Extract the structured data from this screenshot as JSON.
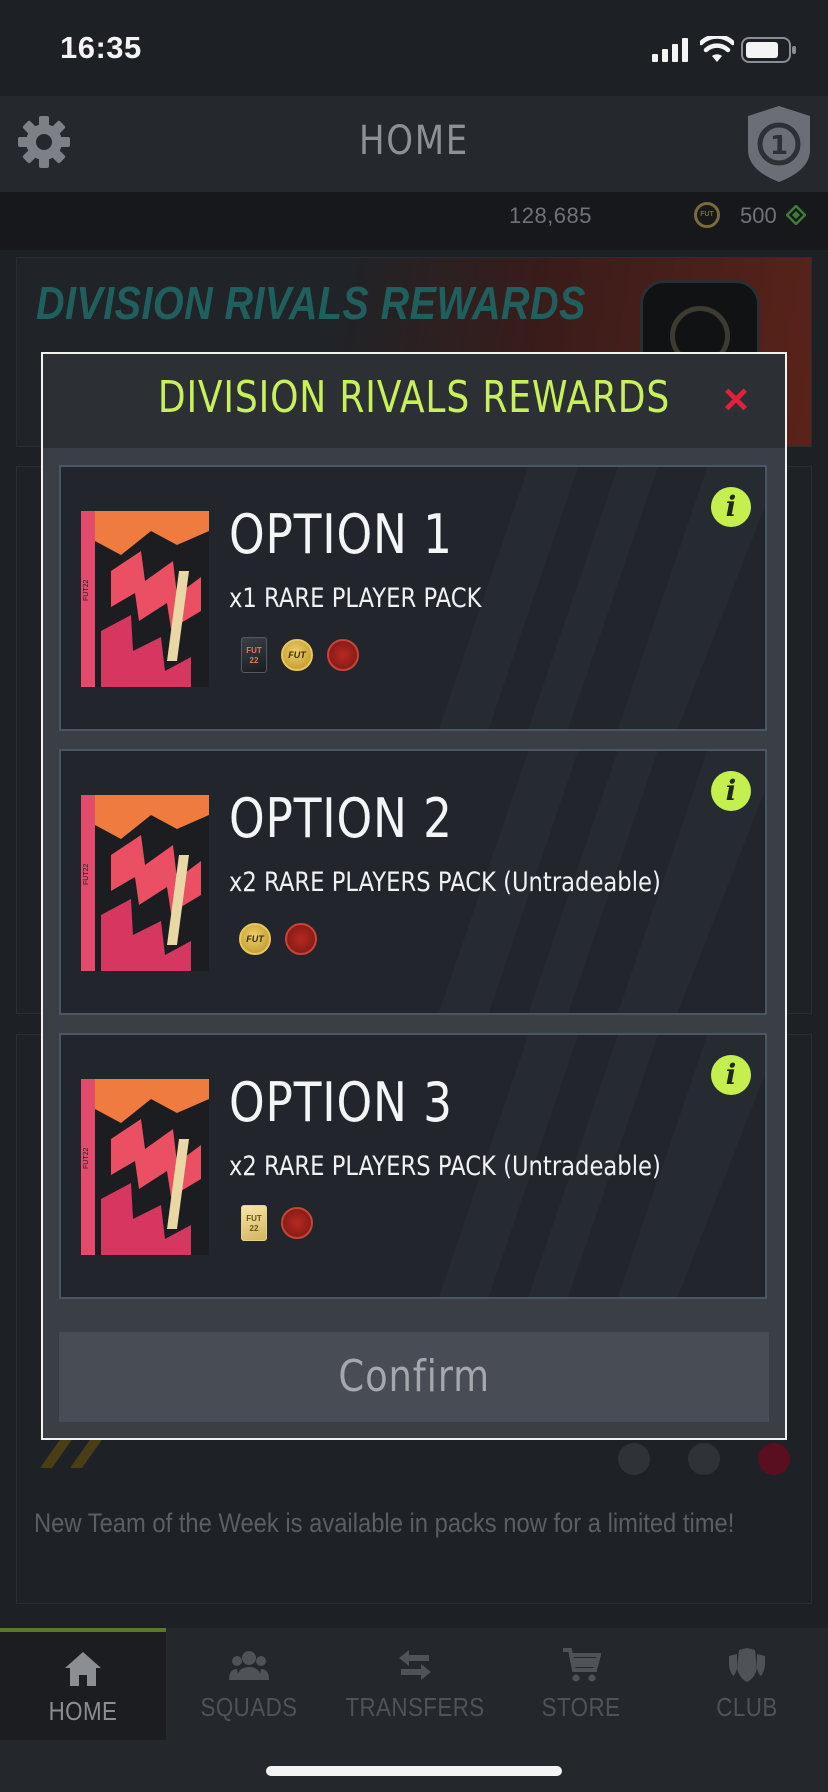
{
  "status_bar": {
    "time": "16:35"
  },
  "header": {
    "title": "HOME"
  },
  "currency": {
    "coins": "128,685",
    "coin_label": "FUT",
    "points": "500"
  },
  "background": {
    "banner_title": "DIVISION RIVALS REWARDS",
    "news_text": "New Team of the Week is available in packs now for a limited time!"
  },
  "modal": {
    "title": "DIVISION RIVALS REWARDS",
    "close_symbol": "×",
    "options": [
      {
        "title": "OPTION 1",
        "description": "x1 RARE PLAYER PACK",
        "rewards": [
          "pack-card-icon",
          "coin-icon",
          "trophy-icon"
        ]
      },
      {
        "title": "OPTION 2",
        "description": "x2 RARE PLAYERS PACK (Untradeable)",
        "rewards": [
          "coin-icon",
          "trophy-icon"
        ]
      },
      {
        "title": "OPTION 3",
        "description": "x2 RARE PLAYERS PACK (Untradeable)",
        "rewards": [
          "gold-card-icon",
          "trophy-icon"
        ]
      }
    ],
    "info_symbol": "i",
    "confirm_label": "Confirm",
    "pack_label": "FUT22",
    "card_label": "FUT 22"
  },
  "bottom_nav": {
    "items": [
      {
        "label": "HOME",
        "icon": "home-icon",
        "active": true
      },
      {
        "label": "SQUADS",
        "icon": "squads-icon",
        "active": false
      },
      {
        "label": "TRANSFERS",
        "icon": "transfers-icon",
        "active": false
      },
      {
        "label": "STORE",
        "icon": "store-icon",
        "active": false
      },
      {
        "label": "CLUB",
        "icon": "club-icon",
        "active": false
      }
    ]
  },
  "colors": {
    "accent_lime": "#c7f05a",
    "close_red": "#e0213d",
    "background": "#1d2024",
    "modal_border": "#f2f2f2"
  }
}
